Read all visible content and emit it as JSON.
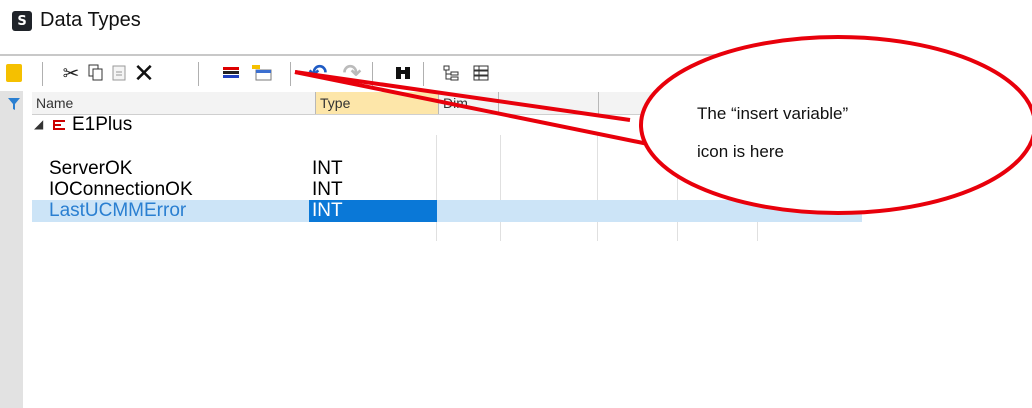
{
  "window": {
    "app_icon_letter": "S",
    "title": "Data Types"
  },
  "toolbar": {
    "buttons": [
      "folder-icon",
      "cut-icon",
      "copy-icon",
      "paste-icon",
      "delete-icon",
      "insert-type-icon",
      "insert-variable-icon",
      "undo-icon",
      "redo-icon",
      "find-icon",
      "tree-view-icon",
      "list-view-icon"
    ]
  },
  "grid": {
    "columns": [
      "Name",
      "Type",
      "Dim."
    ],
    "group": {
      "label": "E1Plus"
    },
    "rows": [
      {
        "name": "ServerOK",
        "type": "INT"
      },
      {
        "name": "IOConnectionOK",
        "type": "INT"
      },
      {
        "name": "LastUCMMError",
        "type": "INT",
        "selected": true
      }
    ]
  },
  "callout": {
    "line1": "The “insert variable”",
    "line2": "icon is here",
    "color": "#e8000b"
  },
  "colors": {
    "selection_row": "#cce4f7",
    "selection_cell": "#0a78d7",
    "selected_text": "#2a7fd1",
    "type_header": "#fde6a9"
  }
}
